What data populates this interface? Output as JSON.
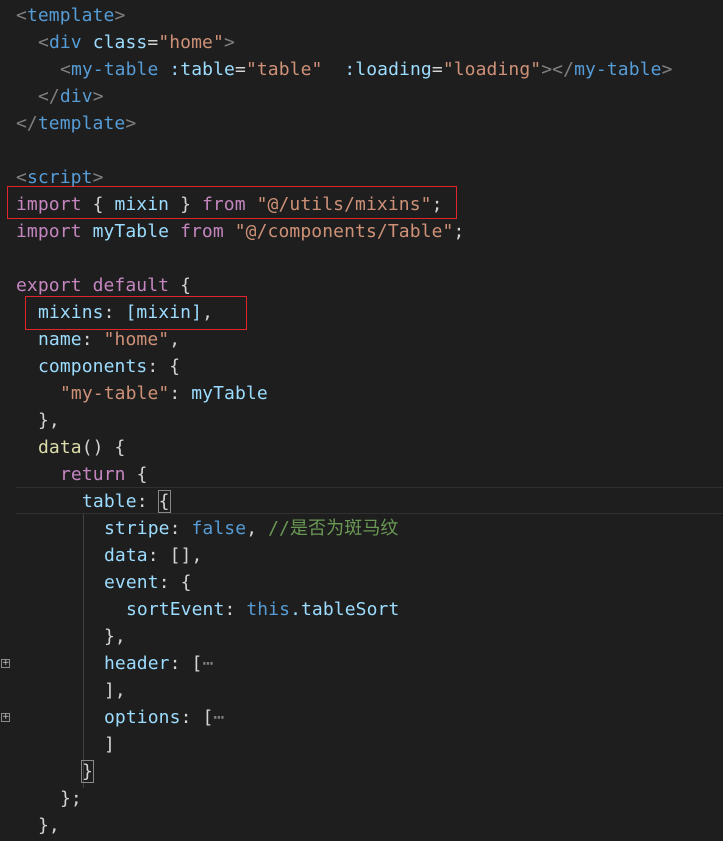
{
  "colors": {
    "background": "#1e1e1e",
    "tag": "#569cd6",
    "attribute": "#9cdcfe",
    "string": "#ce9178",
    "keyword": "#c586c0",
    "comment": "#6a9955",
    "highlight_box": "#e0262a"
  },
  "icons": {
    "fold_toggle": "plus-square-icon"
  },
  "code": {
    "l1": {
      "open": "<",
      "tag": "template",
      "close": ">"
    },
    "l2": {
      "open": "<",
      "tag": "div",
      "attr": "class",
      "eq": "=",
      "val": "\"home\"",
      "close": ">"
    },
    "l3": {
      "open": "<",
      "tag": "my-table",
      "attr1": ":table",
      "eq1": "=",
      "val1": "\"table\"",
      "attr2": ":loading",
      "eq2": "=",
      "val2": "\"loading\"",
      "close_open": "></",
      "tag_end": "my-table",
      "close": ">"
    },
    "l4": {
      "open": "</",
      "tag": "div",
      "close": ">"
    },
    "l5": {
      "open": "</",
      "tag": "template",
      "close": ">"
    },
    "l7": {
      "open": "<",
      "tag": "script",
      "close": ">"
    },
    "l8": {
      "kw_import": "import",
      "lbrace": "{",
      "name": "mixin",
      "rbrace": "}",
      "kw_from": "from",
      "path": "\"@/utils/mixins\"",
      "semi": ";"
    },
    "l9": {
      "kw_import": "import",
      "name": "myTable",
      "kw_from": "from",
      "path": "\"@/components/Table\"",
      "semi": ";"
    },
    "l11": {
      "kw_export": "export",
      "kw_default": "default",
      "brace": "{"
    },
    "l12": {
      "key": "mixins",
      "colon": ":",
      "value": "[mixin]",
      "comma": ","
    },
    "l13": {
      "key": "name",
      "colon": ":",
      "value": "\"home\"",
      "comma": ","
    },
    "l14": {
      "key": "components",
      "colon": ":",
      "brace": "{"
    },
    "l15": {
      "key": "\"my-table\"",
      "colon": ":",
      "value": "myTable"
    },
    "l16": {
      "text": "},"
    },
    "l17": {
      "fn": "data",
      "rest": "() {"
    },
    "l18": {
      "kw_return": "return",
      "brace": "{"
    },
    "l19": {
      "key": "table",
      "colon": ":",
      "brace": "{"
    },
    "l20": {
      "key": "stripe",
      "colon": ":",
      "value": "false",
      "comma": ",",
      "comment": "//是否为斑马纹"
    },
    "l21": {
      "key": "data",
      "rest": ": [],"
    },
    "l22": {
      "key": "event",
      "colon": ":",
      "brace": "{"
    },
    "l23": {
      "key": "sortEvent",
      "colon": ":",
      "kw_this": "this",
      "member": ".tableSort"
    },
    "l24": {
      "text": "},"
    },
    "l25": {
      "key": "header",
      "colon": ":",
      "bracket": "[",
      "ellipsis": "⋯"
    },
    "l26": {
      "text": "],"
    },
    "l27": {
      "key": "options",
      "colon": ":",
      "bracket": "[",
      "ellipsis": "⋯"
    },
    "l28": {
      "text": "]"
    },
    "l29": {
      "text": "}"
    },
    "l30": {
      "text": "};"
    },
    "l31": {
      "text": "},"
    }
  }
}
